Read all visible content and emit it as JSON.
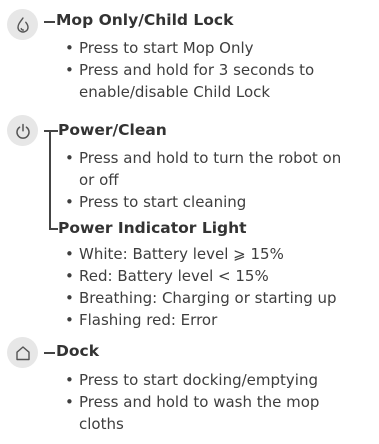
{
  "sections": [
    {
      "title": "Mop Only/Child Lock",
      "icon": "mop-drop-icon",
      "bullets": [
        "Press to start Mop Only",
        "Press and hold for 3 seconds to enable/disable Child Lock"
      ]
    },
    {
      "title": "Power/Clean",
      "icon": "power-icon",
      "bullets": [
        "Press and hold to turn the robot on or off",
        "Press to start cleaning"
      ]
    },
    {
      "title": "Power Indicator Light",
      "bullets": [
        "White: Battery level ⩾ 15%",
        "Red: Battery level < 15%",
        "Breathing: Charging or starting up",
        "Flashing red: Error"
      ]
    },
    {
      "title": "Dock",
      "icon": "home-dock-icon",
      "bullets": [
        "Press to start docking/emptying",
        "Press and hold to wash the mop cloths"
      ]
    }
  ]
}
